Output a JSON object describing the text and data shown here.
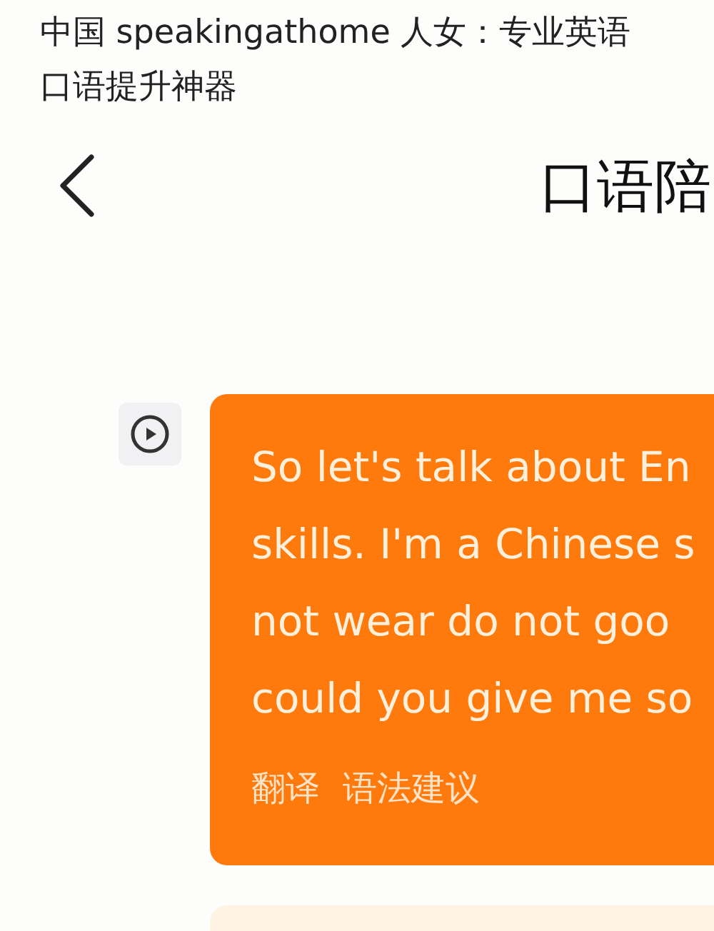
{
  "caption": {
    "lines": [
      "中国 speakingathome 人女：专业英语",
      "口语提升神器"
    ]
  },
  "header": {
    "title": "口语陪"
  },
  "messages": [
    {
      "kind": "ai",
      "lines": [
        "So let's talk about En",
        "skills. I'm a Chinese s",
        "not wear do not goo",
        "could you give me so"
      ],
      "actions": [
        "翻译",
        "语法建议"
      ]
    },
    {
      "kind": "next"
    }
  ]
}
